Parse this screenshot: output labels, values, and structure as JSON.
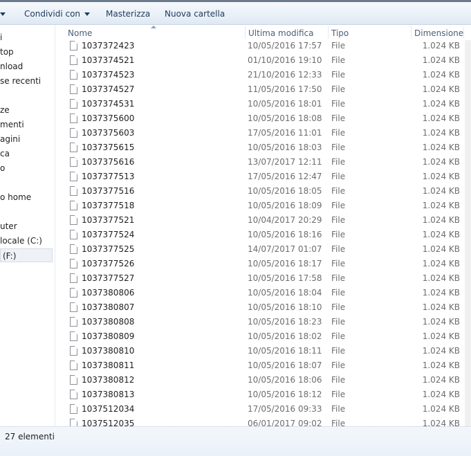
{
  "toolbar": {
    "share_label": "Condividi con",
    "burn_label": "Masterizza",
    "new_folder_label": "Nuova cartella"
  },
  "nav": {
    "items": [
      "i",
      "top",
      "nload",
      "se recenti",
      "",
      "ze",
      "menti",
      "agini",
      "ca",
      "o",
      "",
      "o home",
      "",
      "uter",
      " locale (C:)",
      " (F:)"
    ]
  },
  "columns": {
    "name": "Nome",
    "modified": "Ultima modifica",
    "type": "Tipo",
    "size": "Dimensione"
  },
  "files": [
    {
      "name": "1037372423",
      "date": "10/05/2016 17:57",
      "type": "File",
      "size": "1.024 KB"
    },
    {
      "name": "1037374521",
      "date": "01/10/2016 19:10",
      "type": "File",
      "size": "1.024 KB"
    },
    {
      "name": "1037374523",
      "date": "21/10/2016 12:33",
      "type": "File",
      "size": "1.024 KB"
    },
    {
      "name": "1037374527",
      "date": "11/05/2016 17:50",
      "type": "File",
      "size": "1.024 KB"
    },
    {
      "name": "1037374531",
      "date": "10/05/2016 18:01",
      "type": "File",
      "size": "1.024 KB"
    },
    {
      "name": "1037375600",
      "date": "10/05/2016 18:08",
      "type": "File",
      "size": "1.024 KB"
    },
    {
      "name": "1037375603",
      "date": "17/05/2016 11:01",
      "type": "File",
      "size": "1.024 KB"
    },
    {
      "name": "1037375615",
      "date": "10/05/2016 18:03",
      "type": "File",
      "size": "1.024 KB"
    },
    {
      "name": "1037375616",
      "date": "13/07/2017 12:11",
      "type": "File",
      "size": "1.024 KB"
    },
    {
      "name": "1037377513",
      "date": "17/05/2016 12:47",
      "type": "File",
      "size": "1.024 KB"
    },
    {
      "name": "1037377516",
      "date": "10/05/2016 18:05",
      "type": "File",
      "size": "1.024 KB"
    },
    {
      "name": "1037377518",
      "date": "10/05/2016 18:09",
      "type": "File",
      "size": "1.024 KB"
    },
    {
      "name": "1037377521",
      "date": "10/04/2017 20:29",
      "type": "File",
      "size": "1.024 KB"
    },
    {
      "name": "1037377524",
      "date": "10/05/2016 18:16",
      "type": "File",
      "size": "1.024 KB"
    },
    {
      "name": "1037377525",
      "date": "14/07/2017 01:07",
      "type": "File",
      "size": "1.024 KB"
    },
    {
      "name": "1037377526",
      "date": "10/05/2016 18:17",
      "type": "File",
      "size": "1.024 KB"
    },
    {
      "name": "1037377527",
      "date": "10/05/2016 17:58",
      "type": "File",
      "size": "1.024 KB"
    },
    {
      "name": "1037380806",
      "date": "10/05/2016 18:04",
      "type": "File",
      "size": "1.024 KB"
    },
    {
      "name": "1037380807",
      "date": "10/05/2016 18:10",
      "type": "File",
      "size": "1.024 KB"
    },
    {
      "name": "1037380808",
      "date": "10/05/2016 18:23",
      "type": "File",
      "size": "1.024 KB"
    },
    {
      "name": "1037380809",
      "date": "10/05/2016 18:02",
      "type": "File",
      "size": "1.024 KB"
    },
    {
      "name": "1037380810",
      "date": "10/05/2016 18:11",
      "type": "File",
      "size": "1.024 KB"
    },
    {
      "name": "1037380811",
      "date": "10/05/2016 18:07",
      "type": "File",
      "size": "1.024 KB"
    },
    {
      "name": "1037380812",
      "date": "10/05/2016 18:06",
      "type": "File",
      "size": "1.024 KB"
    },
    {
      "name": "1037380813",
      "date": "10/05/2016 18:12",
      "type": "File",
      "size": "1.024 KB"
    },
    {
      "name": "1037512034",
      "date": "17/05/2016 09:33",
      "type": "File",
      "size": "1.024 KB"
    },
    {
      "name": "1037512035",
      "date": "06/01/2017 09:02",
      "type": "File",
      "size": "1.024 KB"
    }
  ],
  "status": {
    "count_label": "27 elementi"
  }
}
